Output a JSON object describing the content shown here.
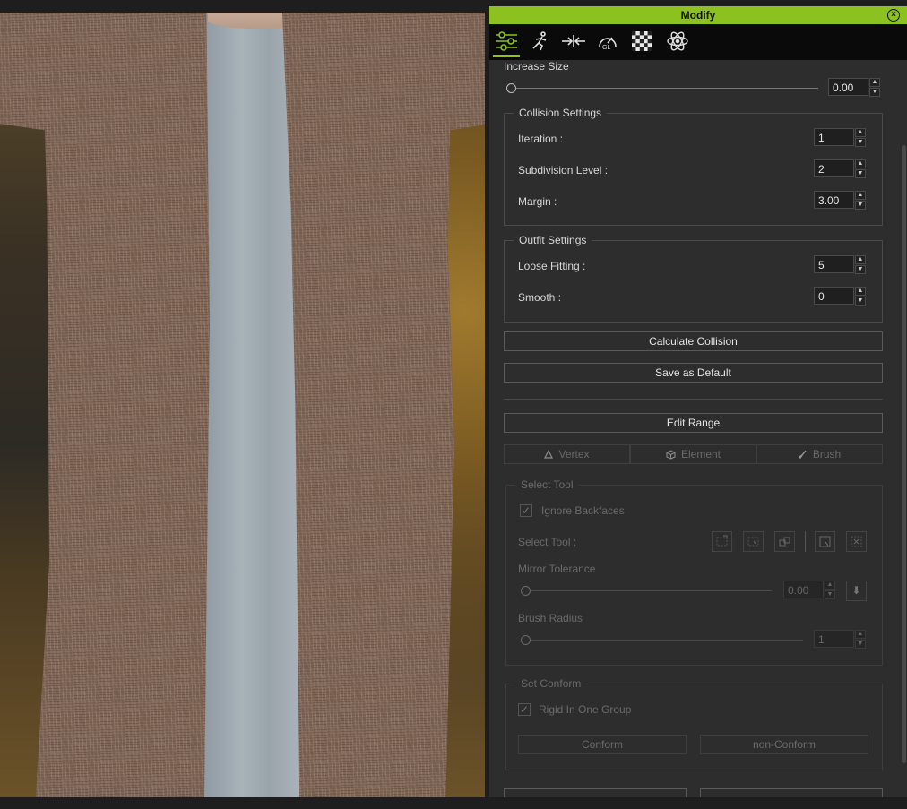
{
  "panel": {
    "title": "Modify",
    "toolbar_tabs": [
      {
        "icon": "sliders-icon",
        "active": true
      },
      {
        "icon": "running-figure-icon",
        "active": false
      },
      {
        "icon": "arrows-inward-icon",
        "active": false
      },
      {
        "icon": "gauge-gl-icon",
        "active": false
      },
      {
        "icon": "checkerboard-icon",
        "active": false
      },
      {
        "icon": "atom-icon",
        "active": false
      }
    ],
    "accent_color": "#8cc21f"
  },
  "increase_size": {
    "label": "Increase Size",
    "value": "0.00",
    "slider_fraction": 0
  },
  "collision_settings": {
    "title": "Collision Settings",
    "iteration": {
      "label": "Iteration :",
      "value": "1"
    },
    "subdivision": {
      "label": "Subdivision Level :",
      "value": "2"
    },
    "margin": {
      "label": "Margin :",
      "value": "3.00"
    }
  },
  "outfit_settings": {
    "title": "Outfit Settings",
    "loose_fitting": {
      "label": "Loose Fitting :",
      "value": "5"
    },
    "smooth": {
      "label": "Smooth :",
      "value": "0"
    }
  },
  "buttons": {
    "calculate_collision": "Calculate Collision",
    "save_default": "Save as Default",
    "edit_range": "Edit Range"
  },
  "mode_tabs": [
    {
      "label": "Vertex",
      "icon": "triangle-vertex-icon"
    },
    {
      "label": "Element",
      "icon": "cube-element-icon"
    },
    {
      "label": "Brush",
      "icon": "brush-icon"
    }
  ],
  "select_tool_group": {
    "title": "Select Tool",
    "ignore_backfaces": {
      "label": "Ignore Backfaces",
      "checked": true
    },
    "select_tool_label": "Select Tool :",
    "mirror_tolerance": {
      "label": "Mirror Tolerance",
      "value": "0.00"
    },
    "brush_radius": {
      "label": "Brush Radius",
      "value": "1"
    }
  },
  "set_conform_group": {
    "title": "Set Conform",
    "rigid_in_one_group": {
      "label": "Rigid In One Group",
      "checked": true
    },
    "conform_button": "Conform",
    "non_conform_button": "non-Conform"
  }
}
